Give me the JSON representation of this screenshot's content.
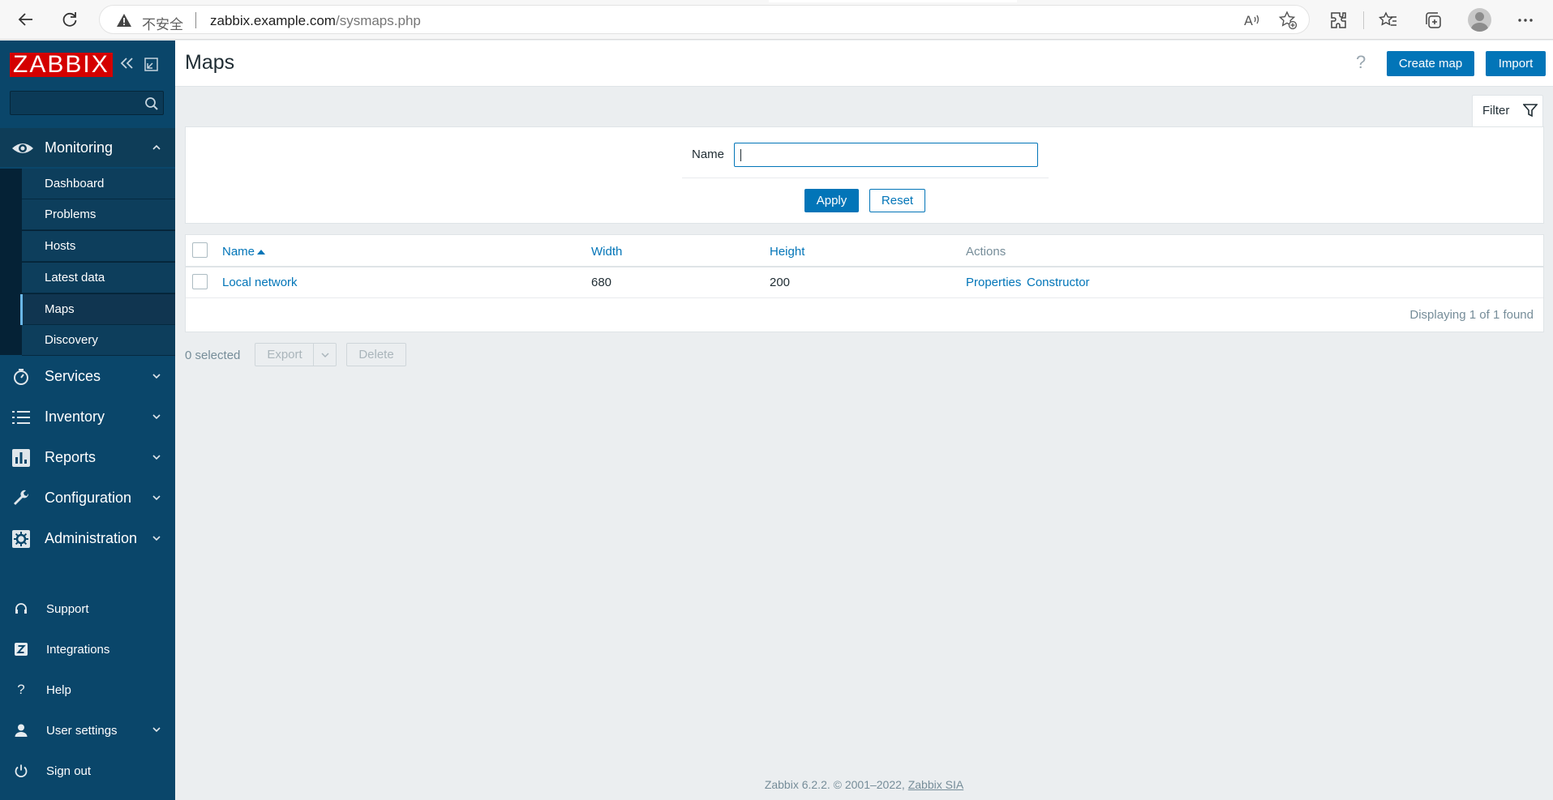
{
  "browser": {
    "insecure_label": "不安全",
    "url_host": "zabbix.example.com",
    "url_path": "/sysmaps.php"
  },
  "sidebar": {
    "logo": "ZABBIX",
    "sections": {
      "monitoring": "Monitoring",
      "services": "Services",
      "inventory": "Inventory",
      "reports": "Reports",
      "configuration": "Configuration",
      "administration": "Administration"
    },
    "monitoring_items": [
      "Dashboard",
      "Problems",
      "Hosts",
      "Latest data",
      "Maps",
      "Discovery"
    ],
    "active_item": "Maps",
    "bottom": {
      "support": "Support",
      "integrations": "Integrations",
      "help": "Help",
      "user_settings": "User settings",
      "sign_out": "Sign out"
    }
  },
  "header": {
    "title": "Maps",
    "help_glyph": "?",
    "create_map": "Create map",
    "import": "Import"
  },
  "filter": {
    "tab_label": "Filter",
    "name_label": "Name",
    "name_value": "",
    "apply": "Apply",
    "reset": "Reset"
  },
  "table": {
    "columns": {
      "name": "Name",
      "width": "Width",
      "height": "Height",
      "actions": "Actions"
    },
    "rows": [
      {
        "name": "Local network",
        "width": "680",
        "height": "200",
        "action_properties": "Properties",
        "action_constructor": "Constructor"
      }
    ],
    "footer": "Displaying 1 of 1 found"
  },
  "mass_actions": {
    "selected": "0 selected",
    "export": "Export",
    "delete": "Delete"
  },
  "footer": {
    "text": "Zabbix 6.2.2. © 2001–2022, ",
    "link": "Zabbix SIA"
  },
  "colors": {
    "sidebar_bg": "#0a466a",
    "accent_blue": "#0275b8",
    "logo_red": "#d40000",
    "page_bg": "#ebeef0"
  }
}
